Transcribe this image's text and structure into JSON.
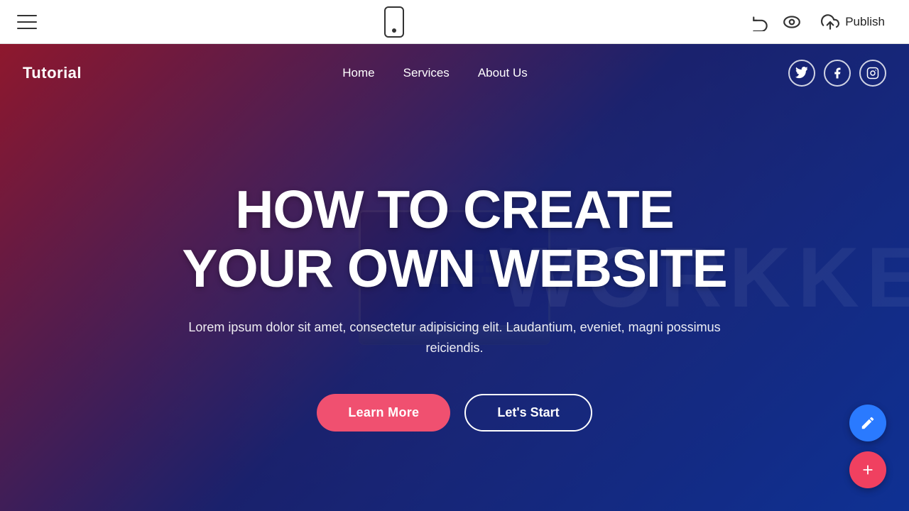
{
  "toolbar": {
    "publish_label": "Publish"
  },
  "site": {
    "logo": "Tutorial",
    "nav": {
      "links": [
        {
          "id": "home",
          "label": "Home"
        },
        {
          "id": "services",
          "label": "Services"
        },
        {
          "id": "about",
          "label": "About Us"
        }
      ]
    },
    "social": [
      {
        "id": "twitter",
        "symbol": "𝕋"
      },
      {
        "id": "facebook",
        "symbol": "f"
      },
      {
        "id": "instagram",
        "symbol": "📷"
      }
    ],
    "hero": {
      "title_line1": "HOW TO CREATE",
      "title_line2": "YOUR OWN WEBSITE",
      "subtitle": "Lorem ipsum dolor sit amet, consectetur adipisicing elit. Laudantium, eveniet, magni possimus reiciendis.",
      "btn_learn_more": "Learn More",
      "btn_lets_start": "Let's Start"
    }
  }
}
